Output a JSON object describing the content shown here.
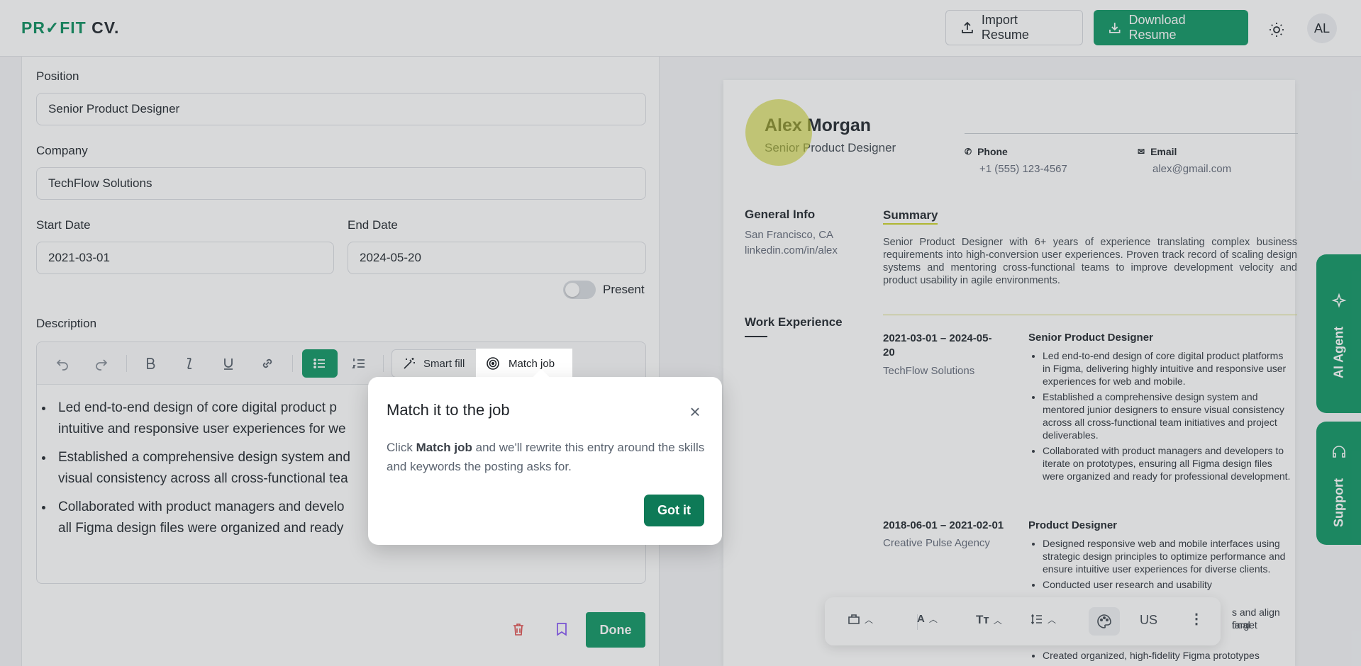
{
  "header": {
    "logo_prefix": "PR",
    "logo_check": "✓",
    "logo_mid": "FIT",
    "logo_suffix": " CV.",
    "import_label": "Import Resume",
    "download_label": "Download Resume",
    "avatar_initials": "AL"
  },
  "form": {
    "position_label": "Position",
    "position_value": "Senior Product Designer",
    "company_label": "Company",
    "company_value": "TechFlow Solutions",
    "start_label": "Start Date",
    "start_value": "2021-03-01",
    "end_label": "End Date",
    "end_value": "2024-05-20",
    "present_label": "Present",
    "description_label": "Description",
    "smart_fill_label": "Smart fill",
    "match_job_label": "Match job",
    "bullets": [
      "Led end-to-end design of core digital product p",
      "intuitive and responsive user experiences for we",
      "Established a comprehensive design system and",
      "visual consistency across all cross-functional tea",
      "Collaborated with product managers and develo",
      "all Figma design files were organized and ready"
    ],
    "done_label": "Done"
  },
  "resume": {
    "name": "Alex Morgan",
    "title": "Senior Product Designer",
    "phone_label": "Phone",
    "phone_value": "+1 (555) 123-4567",
    "email_label": "Email",
    "email_value": "alex@gmail.com",
    "general_info_label": "General Info",
    "location": "San Francisco, CA",
    "linkedin": "linkedin.com/in/alex",
    "summary_label": "Summary",
    "summary_text": "Senior Product Designer with 6+ years of experience translating complex business requirements into high-conversion user experiences. Proven track record of scaling design systems and mentoring cross-functional teams to improve development velocity and product usability in agile environments.",
    "work_label": "Work Experience",
    "jobs": [
      {
        "dates_line1": "2021-03-01 – 2024-05-",
        "dates_line2": "20",
        "company": "TechFlow Solutions",
        "role": "Senior Product Designer",
        "bullets": [
          "Led end-to-end design of core digital product platforms in Figma, delivering highly intuitive and responsive user experiences for web and mobile.",
          "Established a comprehensive design system and mentored junior designers to ensure visual consistency across all cross-functional team initiatives and project deliverables.",
          "Collaborated with product managers and developers to iterate on prototypes, ensuring all Figma design files were organized and ready for professional development."
        ]
      },
      {
        "dates_line1": "2018-06-01 – 2021-02-01",
        "dates_line2": "",
        "company": "Creative Pulse Agency",
        "role": "Product Designer",
        "bullets": [
          "Designed responsive web and mobile interfaces using strategic design principles to optimize performance and ensure intuitive user experiences for diverse clients.",
          "Conducted user research and usability",
          "Created organized, high-fidelity Figma prototypes"
        ],
        "partial_lines": [
          "s and align final",
          "target"
        ]
      }
    ]
  },
  "side_tabs": {
    "ai_agent": "AI Agent",
    "support": "Support"
  },
  "format_bar": {
    "locale": "US"
  },
  "modal": {
    "title": "Match it to the job",
    "text_before": "Click ",
    "text_bold": "Match job",
    "text_after": " and we'll rewrite this entry around the skills and keywords the posting asks for.",
    "confirm_label": "Got it"
  },
  "colors": {
    "brand_green": "#1a9b6c",
    "dark_green": "#0e7a57",
    "highlight_yellow": "#ced532"
  }
}
